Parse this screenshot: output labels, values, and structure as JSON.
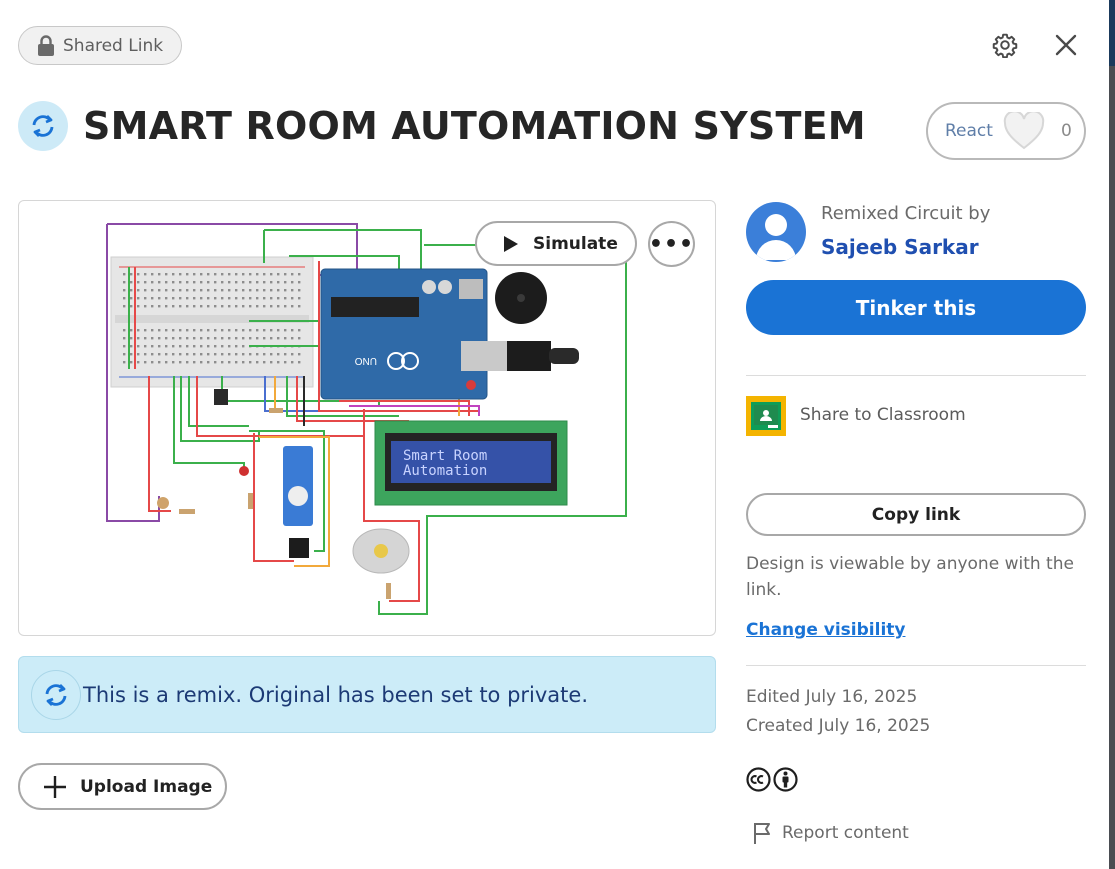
{
  "header": {
    "shared_label": "Shared Link",
    "icons": {
      "lock": "lock-icon",
      "settings": "gear-icon",
      "close": "close-icon"
    }
  },
  "project": {
    "title": "SMART ROOM AUTOMATION SYSTEM",
    "react_label": "React",
    "react_count": "0"
  },
  "canvas": {
    "simulate_label": "Simulate",
    "more_label": "•••",
    "lcd_line1": "Smart Room",
    "lcd_line2": "Automation",
    "board_label": "UNO"
  },
  "remix_notice": "This is a remix. Original has been set to private.",
  "upload_label": "Upload Image",
  "sidebar": {
    "remixed_by": "Remixed Circuit by",
    "author": "Sajeeb Sarkar",
    "tinker_label": "Tinker this",
    "classroom_label": "Share to Classroom",
    "copy_link_label": "Copy link",
    "viewable_text": "Design is viewable by anyone with the link.",
    "change_visibility_label": "Change visibility",
    "edited": "Edited July 16, 2025",
    "created": "Created July 16, 2025",
    "report_label": "Report content"
  },
  "colors": {
    "primary": "#1a73d5",
    "remix_bg": "#ccecf8",
    "author_link": "#1f4fb0",
    "classroom_yellow": "#f4b400",
    "classroom_green": "#0f9d58"
  }
}
